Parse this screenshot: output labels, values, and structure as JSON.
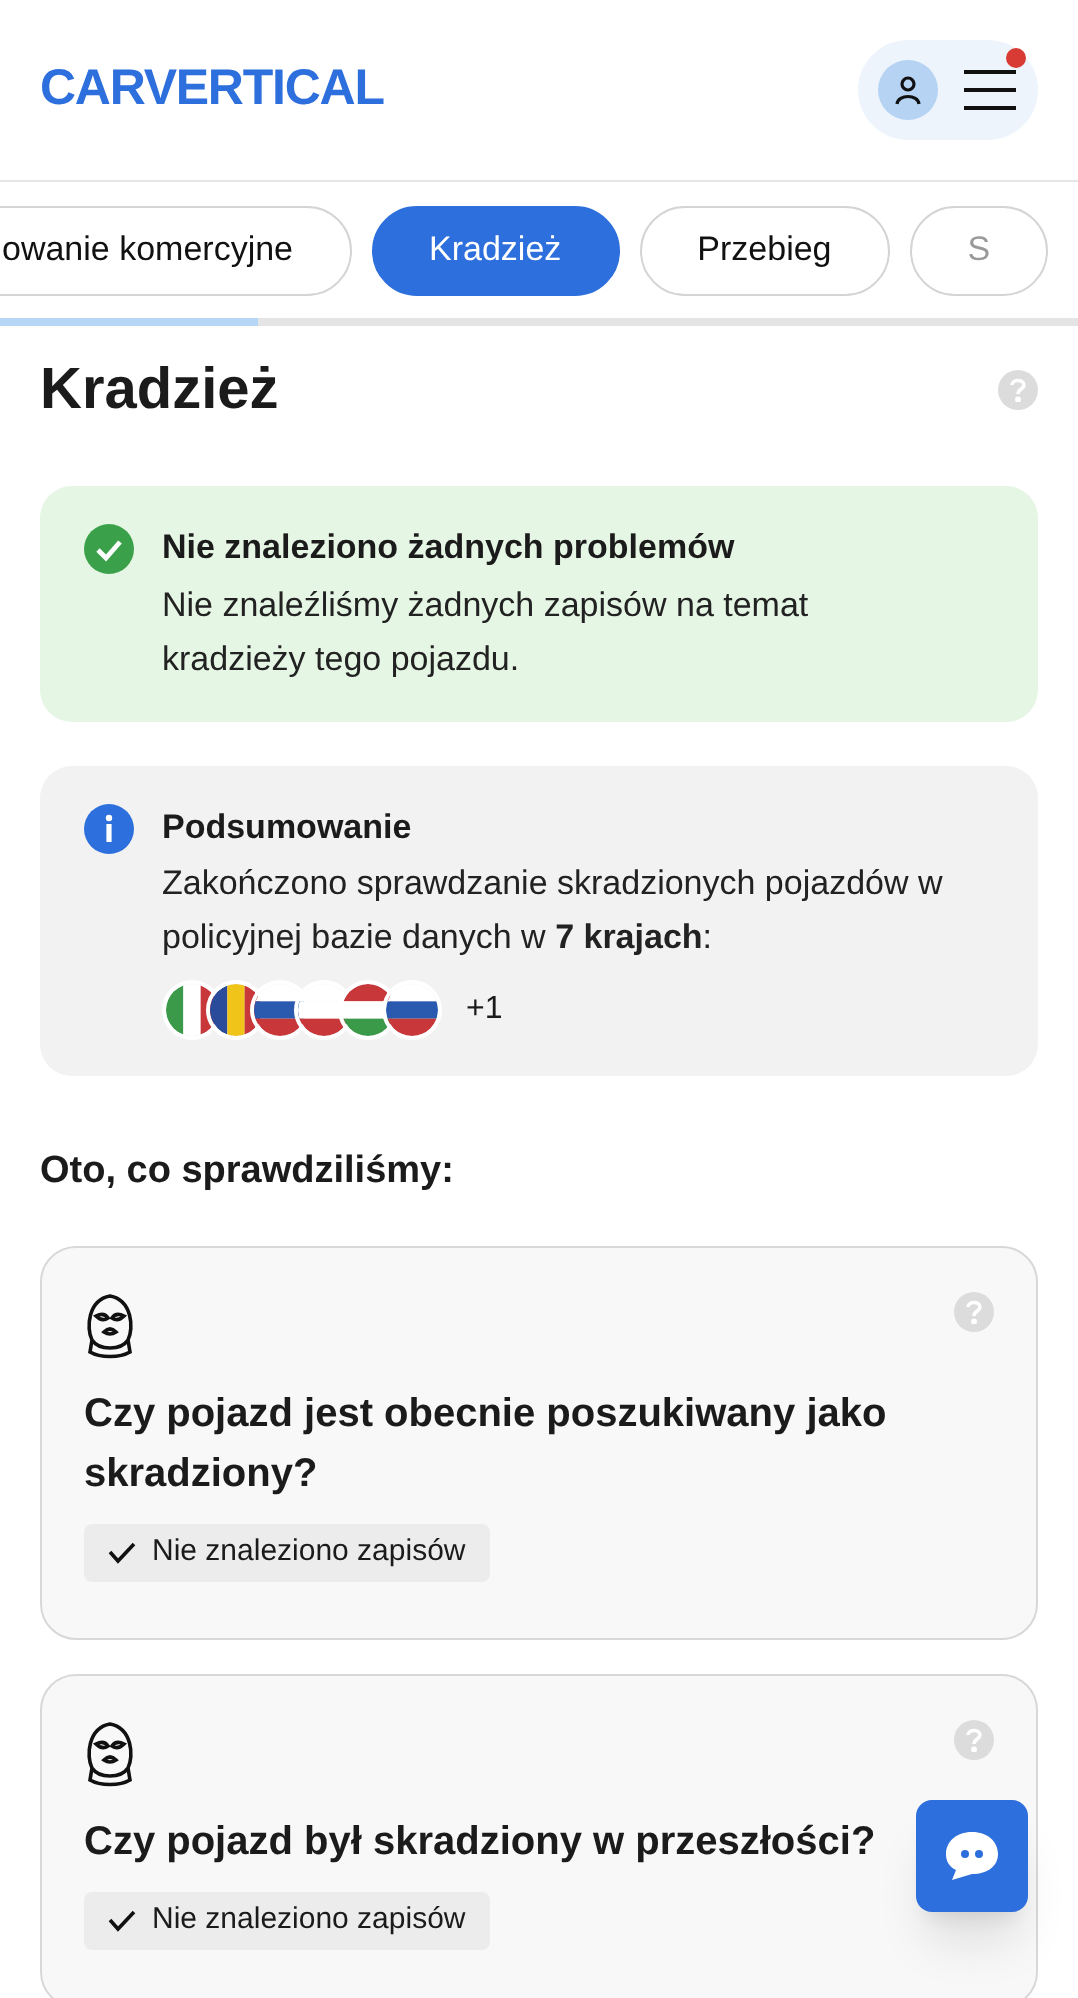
{
  "header": {
    "logo": "CARVERTICAL",
    "menu_notification": true
  },
  "tabs": [
    {
      "label": "owanie komercyjne",
      "selected": false
    },
    {
      "label": "Kradzież",
      "selected": true
    },
    {
      "label": "Przebieg",
      "selected": false
    },
    {
      "label": "S",
      "selected": false
    }
  ],
  "tab_progress": {
    "level": 0.24
  },
  "title": "Kradzież",
  "alerts": [
    {
      "kind": "success",
      "title": "Nie znaleziono żadnych problemów",
      "text": "Nie znaleźliśmy żadnych zapisów na temat kradzieży tego pojazdu."
    },
    {
      "kind": "info",
      "title": "Podsumowanie",
      "text": "Zakończono sprawdzanie skradzionych pojazdów w policyjnej bazie danych w **7 krajach**:",
      "more_countries": "+1"
    }
  ],
  "checks_heading": "Oto, co sprawdziliśmy:",
  "checks": [
    {
      "question": "Czy pojazd jest obecnie poszukiwany jako skradziony?",
      "result": "Nie znaleziono zapisów"
    },
    {
      "question": "Czy pojazd był skradziony w przeszłości?",
      "result": "Nie znaleziono zapisów"
    }
  ]
}
